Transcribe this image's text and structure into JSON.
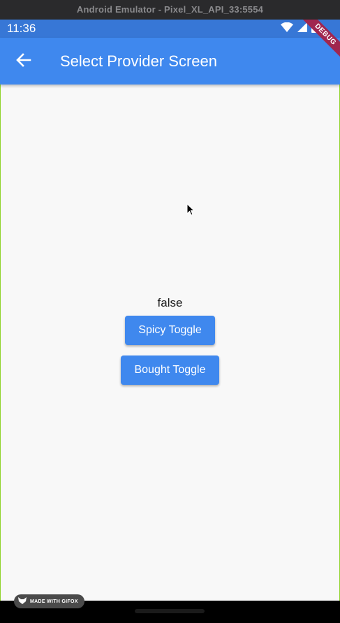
{
  "window": {
    "title": "Android Emulator - Pixel_XL_API_33:5554"
  },
  "status_bar": {
    "time": "11:36",
    "icons": [
      "wifi-icon",
      "cellular-icon",
      "battery-icon"
    ]
  },
  "app_bar": {
    "title": "Select Provider Screen",
    "back_icon": "arrow-back-icon",
    "color": "#3f88ee"
  },
  "debug_banner": {
    "label": "DEBUG",
    "color": "#a0264f"
  },
  "main": {
    "value_text": "false",
    "spicy_button_label": "Spicy Toggle",
    "bought_button_label": "Bought Toggle",
    "button_color": "#3f88ee"
  },
  "watermark": {
    "label": "MADE WITH GIFOX",
    "icon": "fox-icon"
  }
}
